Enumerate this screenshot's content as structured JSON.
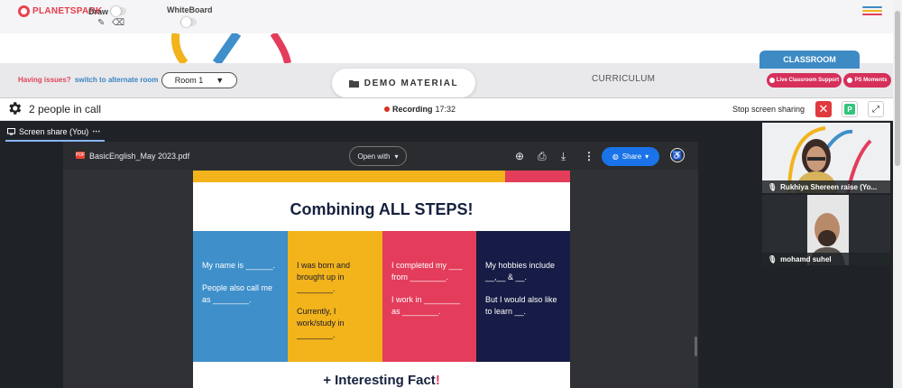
{
  "app": {
    "logo_text": "PLANETSPARK",
    "draw_label": "Draw",
    "whiteboard_label": "WhiteBoard"
  },
  "colors": {
    "brand_red": "#e63c4a",
    "classroom_blue": "#3d8ac5",
    "pill_red": "#d6305b",
    "meet_dark": "#1f2327",
    "share_blue": "#1a73e8"
  },
  "nav": {
    "issues_text": "Having issues?",
    "alternate_room_link": "switch to alternate room",
    "room_value": "Room 1",
    "demo_material_label": "DEMO MATERIAL",
    "curriculum_label": "CURRICULUM",
    "classroom_label": "CLASSROOM",
    "live_support_label": "Live Classroom Support",
    "ps_moments_label": "PS Moments"
  },
  "call": {
    "people_count": "2 people in call",
    "recording_label": "Recording",
    "recording_time": "17:32",
    "stop_share_label": "Stop screen sharing",
    "participant_initial": "P",
    "screen_share_tab": "Screen share (You)"
  },
  "pdf": {
    "icon_text": "PDF",
    "file_name": "BasicEnglish_May 2023.pdf",
    "open_with_label": "Open with",
    "share_label": "Share"
  },
  "slide": {
    "title": "Combining ALL STEPS!",
    "columns": [
      {
        "lines": [
          "My name is ______.",
          "People also call me as ________."
        ]
      },
      {
        "lines": [
          "I was born and brought up in ________.",
          "Currently, I work/study in ________."
        ]
      },
      {
        "lines": [
          "I completed my ___ from ________.",
          "I work in ________ as ________."
        ]
      },
      {
        "lines": [
          "My hobbies include __,__ & __.",
          "But I would also like to learn __."
        ]
      }
    ],
    "fact_text": "+ Interesting Fact",
    "fact_mark": "!"
  },
  "participants": [
    {
      "name": "Rukhiya Shereen raise (Yo..."
    },
    {
      "name": "mohamd suhel"
    }
  ]
}
